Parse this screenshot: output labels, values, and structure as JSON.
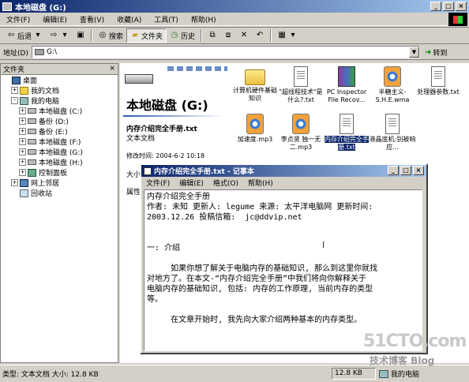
{
  "window": {
    "title": "本地磁盘 (G:)"
  },
  "menubar": [
    "文件(F)",
    "编辑(E)",
    "查看(V)",
    "收藏(A)",
    "工具(T)",
    "帮助(H)"
  ],
  "toolbar": {
    "back": "后退",
    "search": "搜索",
    "folders": "文件夹",
    "history": "历史"
  },
  "address": {
    "label": "地址(D)",
    "value": "G:\\",
    "go": "转到"
  },
  "folders_panel": {
    "title": "文件夹",
    "items": [
      {
        "label": "桌面",
        "icon": "desktop-icon",
        "level": 0,
        "expand": ""
      },
      {
        "label": "我的文档",
        "icon": "documents-icon",
        "level": 1,
        "expand": "+"
      },
      {
        "label": "我的电脑",
        "icon": "computer-icon",
        "level": 1,
        "expand": "-"
      },
      {
        "label": "本地磁盘 (C:)",
        "icon": "disk-icon",
        "level": 2,
        "expand": "+"
      },
      {
        "label": "备份 (D:)",
        "icon": "disk-icon",
        "level": 2,
        "expand": "+"
      },
      {
        "label": "备份 (E:)",
        "icon": "disk-icon",
        "level": 2,
        "expand": "+"
      },
      {
        "label": "本地磁盘 (F:)",
        "icon": "disk-icon",
        "level": 2,
        "expand": "+"
      },
      {
        "label": "本地磁盘 (G:)",
        "icon": "disk-icon",
        "level": 2,
        "expand": "+"
      },
      {
        "label": "本地磁盘 (H:)",
        "icon": "disk-icon",
        "level": 2,
        "expand": "+"
      },
      {
        "label": "控制面板",
        "icon": "control-panel-icon",
        "level": 2,
        "expand": "+"
      },
      {
        "label": "网上邻居",
        "icon": "network-icon",
        "level": 1,
        "expand": "+"
      },
      {
        "label": "回收站",
        "icon": "recycle-bin-icon",
        "level": 1,
        "expand": ""
      }
    ]
  },
  "content": {
    "drive_title": "本地磁盘 (G:)",
    "selected": {
      "name": "内存介绍完全手册.txt",
      "type": "文本文档",
      "modified": "修改时间: 2004-6-2 10:18",
      "size_label": "大小",
      "attr_label": "属性"
    },
    "files": [
      {
        "label": "计算机硬件基础知识",
        "kind": "folder",
        "col": 0,
        "row": 0
      },
      {
        "label": "\"超线程技术\"是什么?.txt",
        "kind": "txt",
        "col": 1,
        "row": 0
      },
      {
        "label": "PC Inspector File Recov...",
        "kind": "rar",
        "col": 2,
        "row": 0
      },
      {
        "label": "半糖主义-S.H.E.wma",
        "kind": "wma",
        "col": 3,
        "row": 0
      },
      {
        "label": "处理器参数.txt",
        "kind": "txt",
        "col": 4,
        "row": 0
      },
      {
        "label": "加速度.mp3",
        "kind": "mp3",
        "col": 0,
        "row": 1
      },
      {
        "label": "李贞贤 独一无二.mp3",
        "kind": "mp3",
        "col": 1,
        "row": 1
      },
      {
        "label": "内存介绍完全手册.txt",
        "kind": "txt",
        "col": 2,
        "row": 1,
        "selected": true
      },
      {
        "label": "液晶底机:别被响应...",
        "kind": "txt",
        "col": 3,
        "row": 1
      }
    ]
  },
  "notepad": {
    "title": "内存介绍完全手册.txt - 记事本",
    "menu": [
      "文件(F)",
      "编辑(E)",
      "格式(O)",
      "帮助(H)"
    ],
    "text": "内存介绍完全手册\n作者: 未知 更新人: legume 来源: 太平洋电脑网 更新时间:\n2003.12.26 投稿信箱:  jc@ddvip.net\n\n\n一: 介绍\n\n     如果你想了解关于电脑内存的基础知识, 那么到这里你就找\n对地方了。在本文-“内存介绍完全手册”中我们将向你解释关于\n电脑内存的基础知识, 包括: 内存的工作原理, 当前内存的类型\n等。\n\n     在文章开始时, 我先向大家介绍两种基本的内存类型。"
  },
  "statusbar": {
    "left": "类型: 文本文档 大小: 12.8 KB",
    "mid": "12.8 KB",
    "right": "我的电脑"
  },
  "watermark": {
    "site": "51CTO.com",
    "blog": "技术博客 Blog"
  }
}
